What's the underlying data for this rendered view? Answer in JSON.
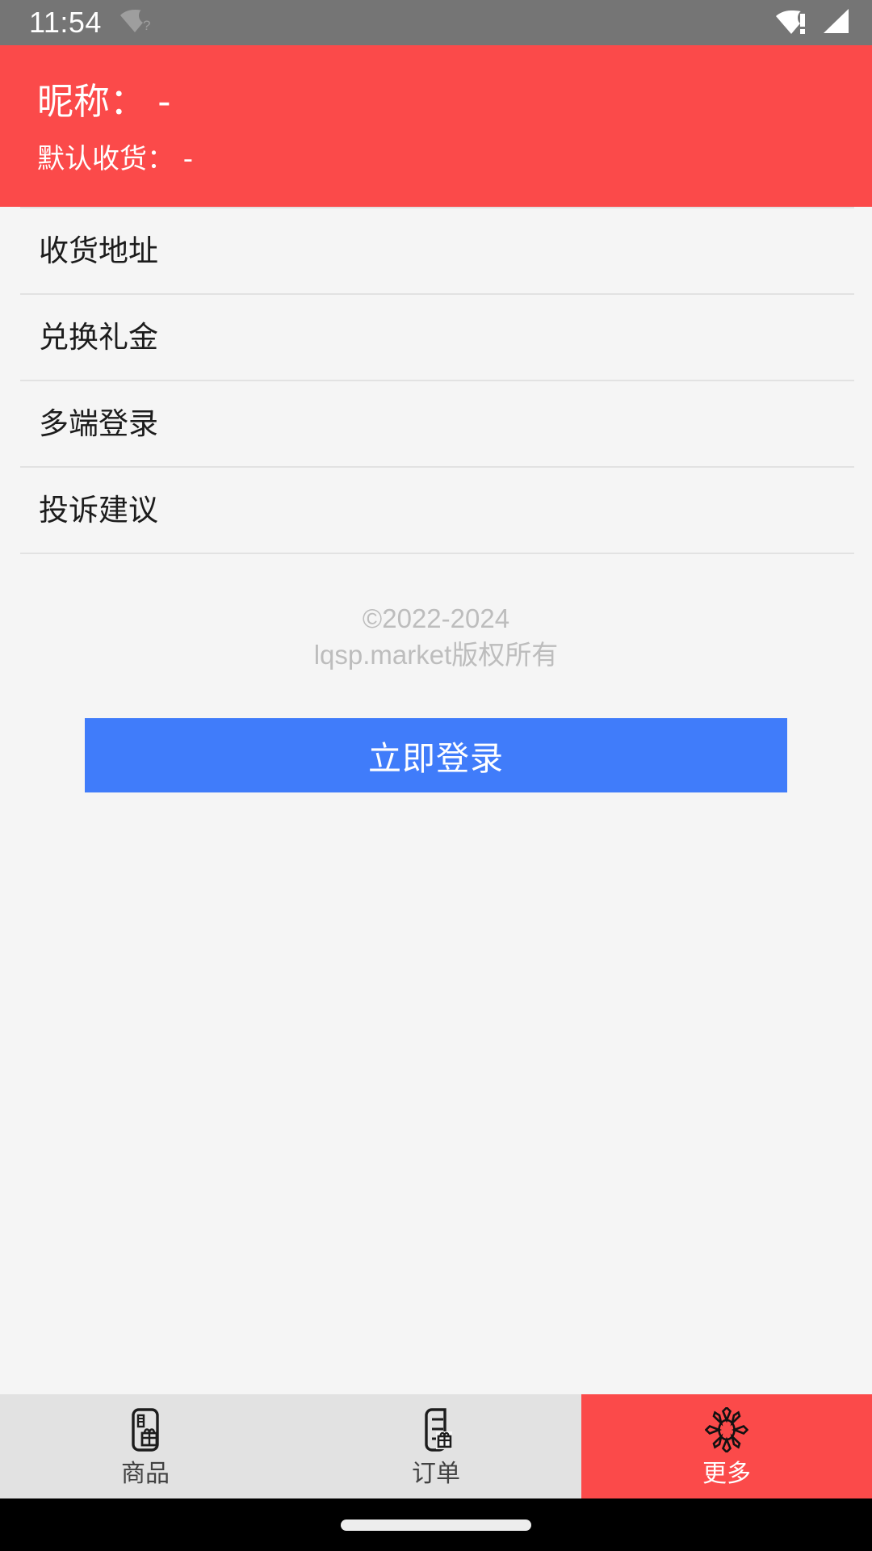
{
  "status_bar": {
    "time": "11:54",
    "icons": {
      "wifi_unknown": "wifi-unknown-icon",
      "wifi_alert": "wifi-alert-icon",
      "cell_signal": "cell-signal-icon"
    },
    "background_color": "#757575"
  },
  "profile": {
    "nickname_label": "昵称：",
    "nickname_value": "-",
    "nickname_line": "昵称： -",
    "address_label": "默认收货：",
    "address_value": "-",
    "address_line": "默认收货： -",
    "background_color": "#FB4A4A"
  },
  "menu": {
    "items": [
      {
        "label": "收货地址",
        "name": "shipping-address"
      },
      {
        "label": "兑换礼金",
        "name": "redeem-gift"
      },
      {
        "label": "多端登录",
        "name": "multi-device-login"
      },
      {
        "label": "投诉建议",
        "name": "complaints-suggestions"
      }
    ]
  },
  "copyright": {
    "line1": "©2022-2024",
    "line2": "lqsp.market版权所有",
    "color": "#BDBDBD"
  },
  "login": {
    "label": "立即登录",
    "background_color": "#407CFA",
    "text_color": "#FFFFFF"
  },
  "tab_bar": {
    "background_color": "#E2E2E2",
    "active_color": "#FB4A4A",
    "tabs": [
      {
        "label": "商品",
        "icon": "product-card-gift-icon",
        "active": false
      },
      {
        "label": "订单",
        "icon": "order-list-gift-icon",
        "active": false
      },
      {
        "label": "更多",
        "icon": "sunburst-more-icon",
        "active": true
      }
    ]
  },
  "system_nav": {
    "home_indicator": "home-indicator",
    "background_color": "#000000"
  }
}
